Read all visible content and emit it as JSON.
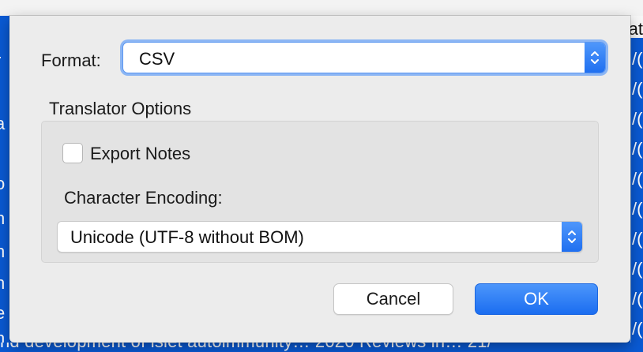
{
  "background": {
    "top_right_text": "at",
    "left_column_chars": [
      "r",
      "a",
      "o",
      "n",
      "n",
      "n",
      "e",
      "n"
    ],
    "right_column_chars": [
      "/(",
      "/(",
      "/(",
      "/(",
      "/(",
      "/(",
      "/(",
      "/(",
      "/(",
      "/(",
      "/("
    ],
    "bottom_row_text": "nd development of islet autoimmunity…  2020   Reviews in…  21/"
  },
  "dialog": {
    "format_label": "Format:",
    "format_value": "CSV",
    "translator_options_title": "Translator Options",
    "export_notes_label": "Export Notes",
    "export_notes_checked": false,
    "character_encoding_label": "Character Encoding:",
    "character_encoding_value": "Unicode (UTF-8 without BOM)",
    "cancel_label": "Cancel",
    "ok_label": "OK"
  },
  "colors": {
    "accent": "#1f6ff0",
    "selection_blue": "#0a5ad4",
    "dialog_bg": "#ececec"
  }
}
